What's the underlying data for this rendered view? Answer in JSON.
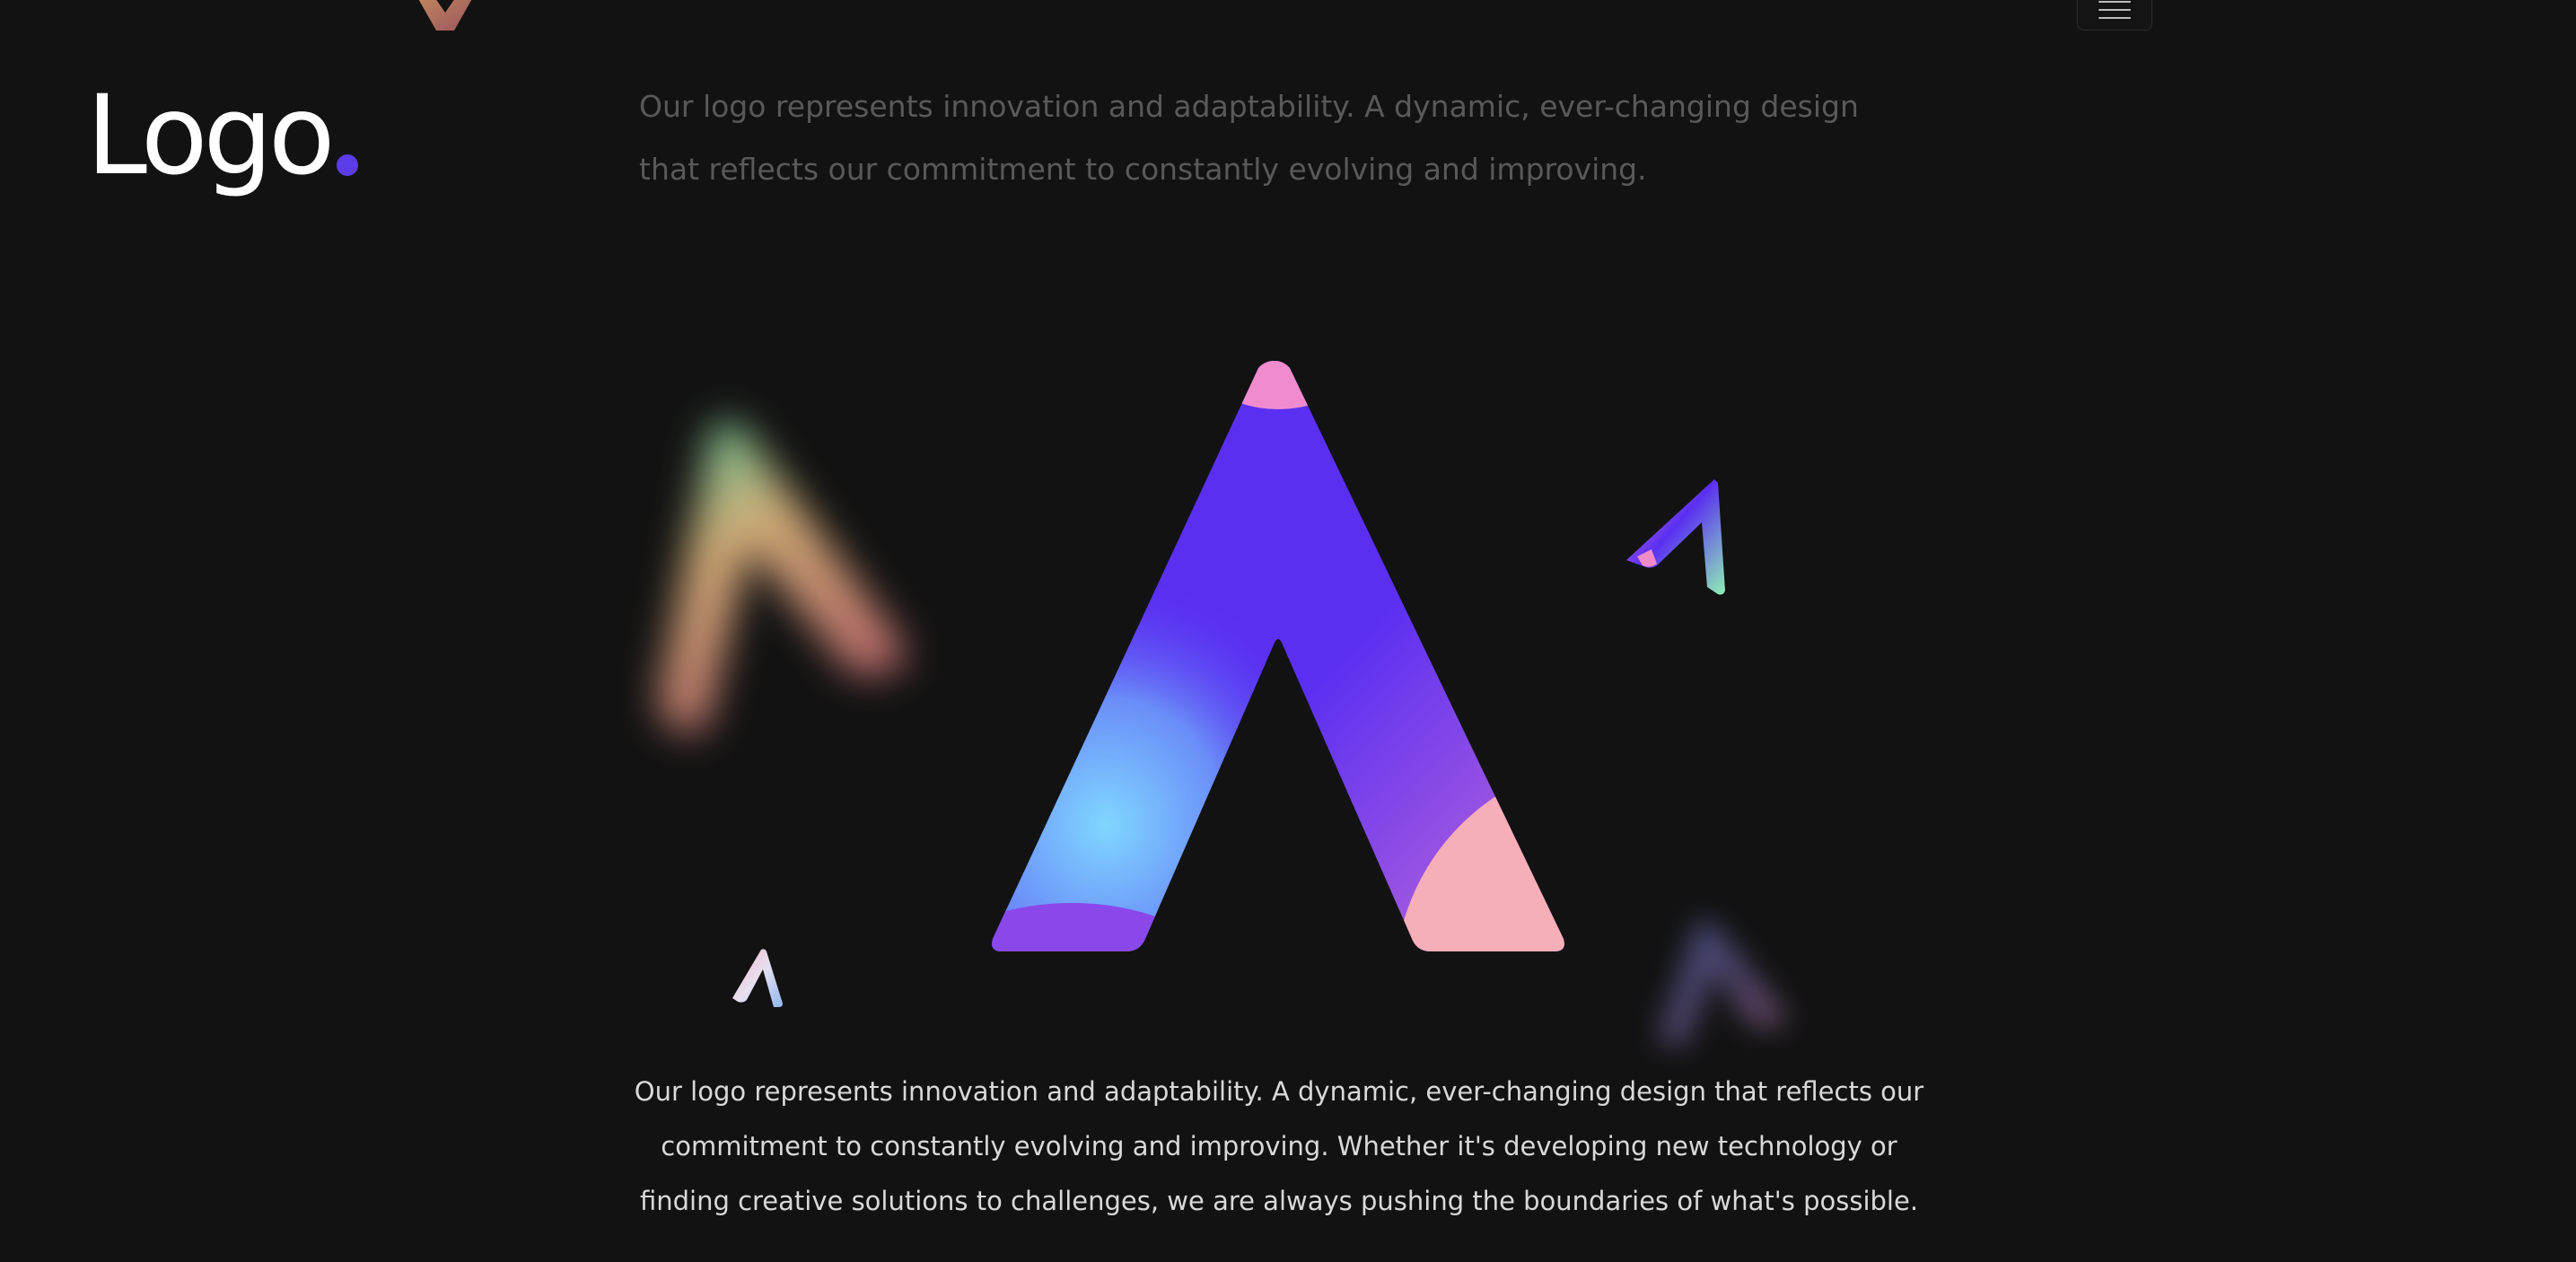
{
  "brand": {
    "wordmark": "Logo",
    "dot_color": "#5b3ce6"
  },
  "intro": {
    "text": "Our logo represents innovation and adaptability. A dynamic, ever-changing design that reflects our commitment to constantly evolving and improving."
  },
  "menu": {
    "icon": "hamburger-menu-icon"
  },
  "hero": {
    "main_mark_icon": "logo-a-mark",
    "accent_colors": [
      "#5a2ff2",
      "#7fd3ff",
      "#f29ac9",
      "#f7b1b8",
      "#8f46e6"
    ]
  },
  "description": {
    "text": "Our logo represents innovation and adaptability. A dynamic, ever-changing design that reflects our commitment to constantly evolving and improving. Whether it's developing new technology or finding creative solutions to challenges, we are always pushing the boundaries of what's possible."
  }
}
